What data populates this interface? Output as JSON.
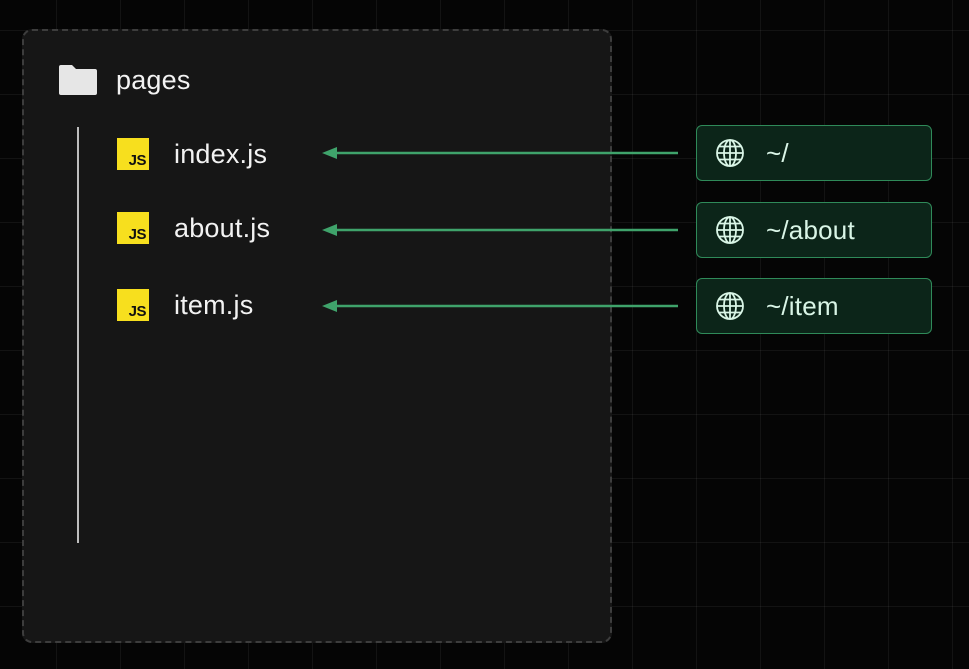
{
  "folder": {
    "icon": "folder-icon",
    "name": "pages"
  },
  "files": [
    {
      "icon": "javascript-file-icon",
      "badge": "JS",
      "name": "index.js"
    },
    {
      "icon": "javascript-file-icon",
      "badge": "JS",
      "name": "about.js"
    },
    {
      "icon": "javascript-file-icon",
      "badge": "JS",
      "name": "item.js"
    }
  ],
  "routes": [
    {
      "icon": "globe-icon",
      "path": "~/"
    },
    {
      "icon": "globe-icon",
      "path": "~/about"
    },
    {
      "icon": "globe-icon",
      "path": "~/item"
    }
  ],
  "colors": {
    "background": "#050505",
    "panel": "#161616",
    "panel_border": "#3d3d3d",
    "js_yellow": "#f7df1e",
    "arrow_green": "#3fa36b",
    "route_border": "#2f8a59",
    "route_fill": "#0c2519"
  }
}
